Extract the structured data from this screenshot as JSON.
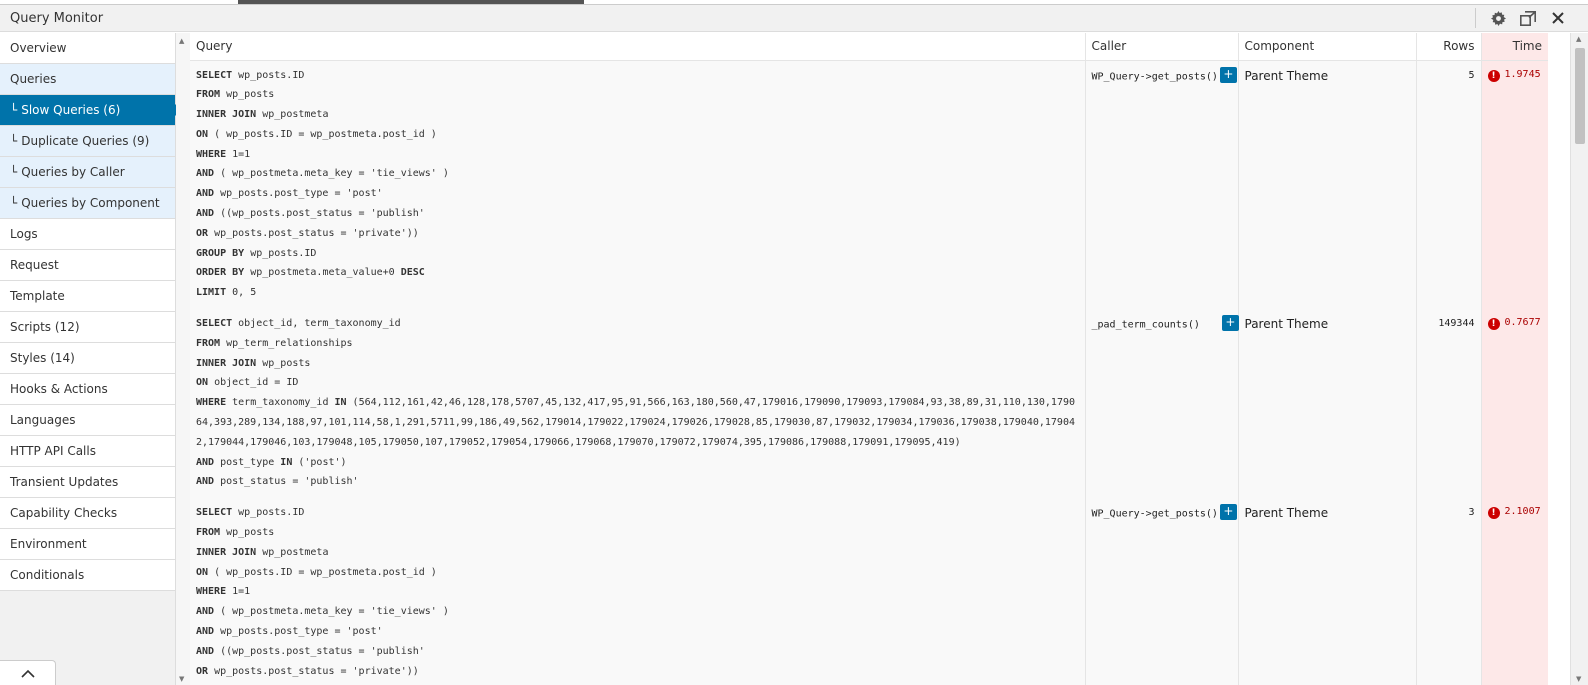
{
  "window": {
    "title": "Query Monitor"
  },
  "icons": {
    "settings": "gear-icon",
    "popout": "popout-icon",
    "close": "close-icon",
    "collapse": "chevron-up-icon",
    "warning": "warning-icon"
  },
  "colors": {
    "accent": "#0073aa",
    "time_bg": "#fde8e8",
    "warning": "#cc0000"
  },
  "sidebar": {
    "items": [
      {
        "label": "Overview"
      },
      {
        "label": "Queries"
      },
      {
        "label": "Slow Queries (6)",
        "tree": "└"
      },
      {
        "label": "Duplicate Queries (9)",
        "tree": "└"
      },
      {
        "label": "Queries by Caller",
        "tree": "└"
      },
      {
        "label": "Queries by Component",
        "tree": "└"
      },
      {
        "label": "Logs"
      },
      {
        "label": "Request"
      },
      {
        "label": "Template"
      },
      {
        "label": "Scripts (12)"
      },
      {
        "label": "Styles (14)"
      },
      {
        "label": "Hooks & Actions"
      },
      {
        "label": "Languages"
      },
      {
        "label": "HTTP API Calls"
      },
      {
        "label": "Transient Updates"
      },
      {
        "label": "Capability Checks"
      },
      {
        "label": "Environment"
      },
      {
        "label": "Conditionals"
      }
    ]
  },
  "table": {
    "headers": {
      "query": "Query",
      "caller": "Caller",
      "component": "Component",
      "rows": "Rows",
      "time": "Time"
    },
    "plus_label": "+",
    "warning_glyph": "!",
    "rows": [
      {
        "sql": [
          "SELECT wp_posts.ID",
          "FROM wp_posts",
          "INNER JOIN wp_postmeta",
          "ON ( wp_posts.ID = wp_postmeta.post_id )",
          "WHERE 1=1",
          "AND ( wp_postmeta.meta_key = 'tie_views' )",
          "AND wp_posts.post_type = 'post'",
          "AND ((wp_posts.post_status = 'publish'",
          "OR wp_posts.post_status = 'private'))",
          "GROUP BY wp_posts.ID",
          "ORDER BY wp_postmeta.meta_value+0 DESC",
          "LIMIT 0, 5"
        ],
        "caller": "WP_Query->get_posts()",
        "component": "Parent Theme",
        "rows": "5",
        "time": "1.9745"
      },
      {
        "sql": [
          "SELECT object_id, term_taxonomy_id",
          "FROM wp_term_relationships",
          "INNER JOIN wp_posts",
          "ON object_id = ID",
          "WHERE term_taxonomy_id IN (564,112,161,42,46,128,178,5707,45,132,417,95,91,566,163,180,560,47,179016,179090,179093,179084,93,38,89,31,110,130,179064,393,289,134,188,97,101,114,58,1,291,5711,99,186,49,562,179014,179022,179024,179026,179028,85,179030,87,179032,179034,179036,179038,179040,179042,179044,179046,103,179048,105,179050,107,179052,179054,179066,179068,179070,179072,179074,395,179086,179088,179091,179095,419)",
          "AND post_type IN ('post')",
          "AND post_status = 'publish'"
        ],
        "caller": "_pad_term_counts()",
        "component": "Parent Theme",
        "rows": "149344",
        "time": "0.7677"
      },
      {
        "sql": [
          "SELECT wp_posts.ID",
          "FROM wp_posts",
          "INNER JOIN wp_postmeta",
          "ON ( wp_posts.ID = wp_postmeta.post_id )",
          "WHERE 1=1",
          "AND ( wp_postmeta.meta_key = 'tie_views' )",
          "AND wp_posts.post_type = 'post'",
          "AND ((wp_posts.post_status = 'publish'",
          "OR wp_posts.post_status = 'private'))"
        ],
        "caller": "WP_Query->get_posts()",
        "component": "Parent Theme",
        "rows": "3",
        "time": "2.1007"
      }
    ]
  }
}
